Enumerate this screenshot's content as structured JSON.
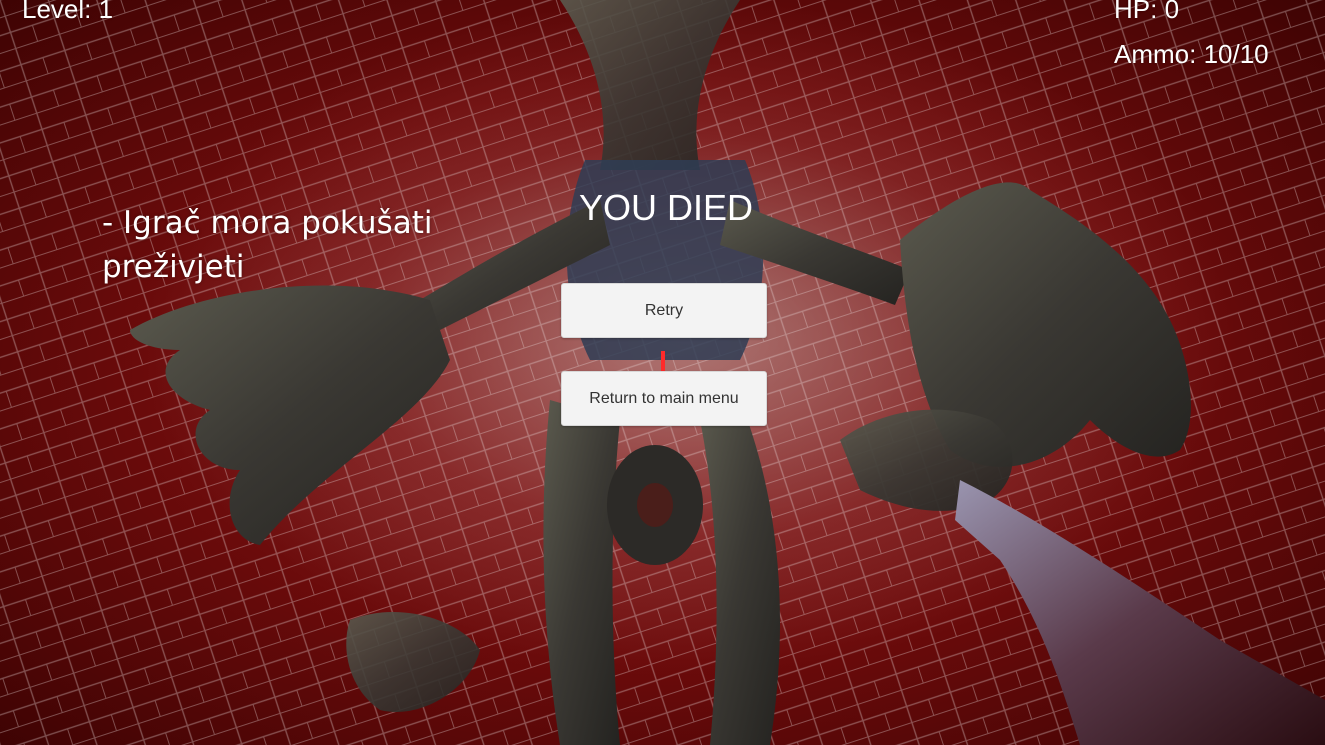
{
  "hud": {
    "level": "Level: 1",
    "hp": "HP: 0",
    "ammo": "Ammo: 10/10"
  },
  "caption": {
    "line1": "- Igrač mora pokušati",
    "line2": "preživjeti"
  },
  "death_screen": {
    "title": "YOU DIED",
    "retry_label": "Retry",
    "main_menu_label": "Return to main menu"
  },
  "colors": {
    "crosshair": "#ff2a2a",
    "background_red": "#6b0b0b",
    "button_bg": "#f3f3f3"
  },
  "icons": {
    "crosshair": "crosshair-icon",
    "weapon": "rifle-icon"
  }
}
